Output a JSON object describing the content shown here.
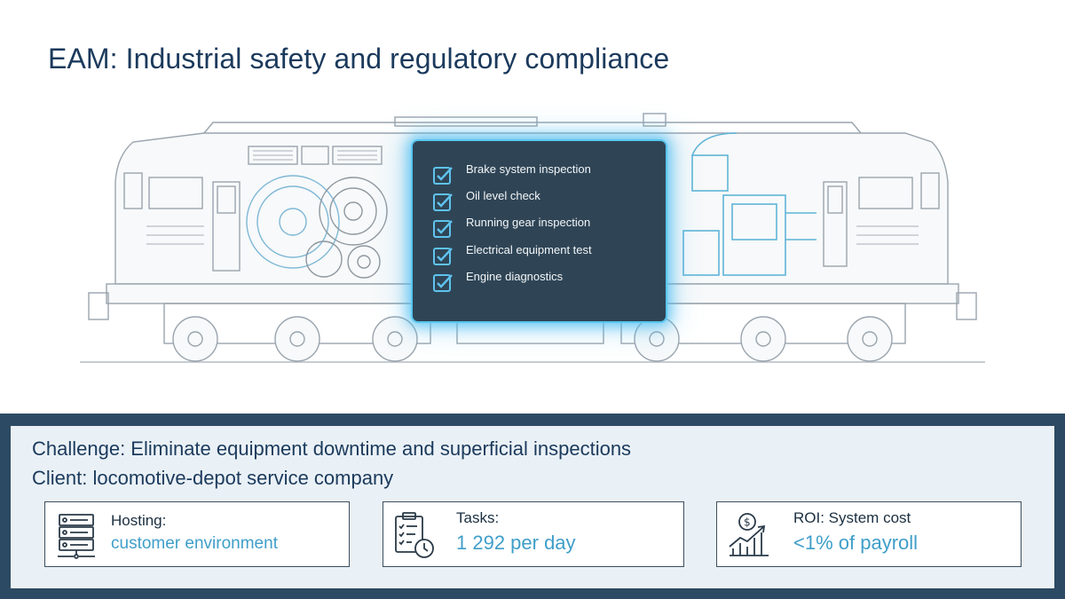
{
  "title": "EAM: Industrial safety and regulatory compliance",
  "checklist": {
    "items": [
      "Brake system inspection",
      "Oil level check",
      "Running gear inspection",
      "Electrical equipment test",
      "Engine diagnostics"
    ]
  },
  "info": {
    "challenge": "Challenge: Eliminate equipment downtime and superficial inspections",
    "client": "Client: locomotive-depot service company"
  },
  "cards": {
    "hosting": {
      "label": "Hosting:",
      "value": "customer environment",
      "icon": "server-icon"
    },
    "tasks": {
      "label": "Tasks:",
      "value": "1 292 per day",
      "icon": "checklist-clock-icon"
    },
    "roi": {
      "label": "ROI: System cost",
      "value": "<1% of payroll",
      "icon": "money-growth-chart-icon"
    }
  },
  "colors": {
    "title": "#1b3a5c",
    "accent": "#3f9ec9",
    "panel": "#2f4556",
    "glow": "#58c6f0",
    "footer_border": "#2c4a63",
    "footer_bg": "#eaf1f6"
  }
}
